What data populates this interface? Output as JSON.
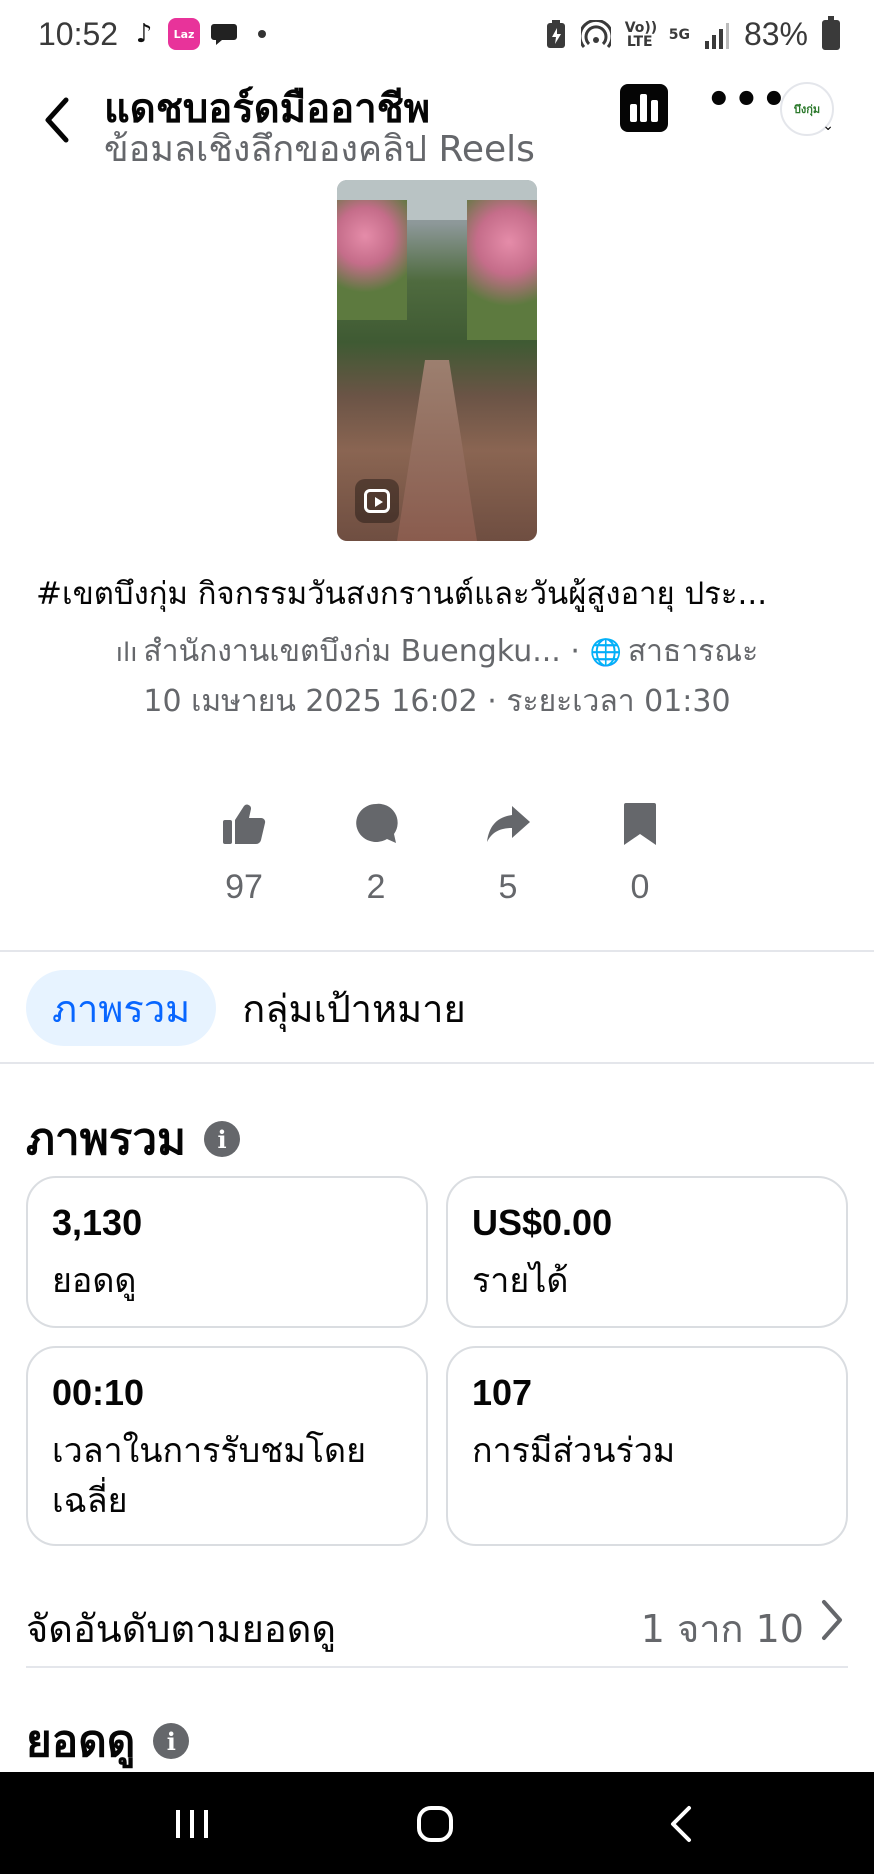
{
  "status_bar": {
    "time": "10:52",
    "network": "5G",
    "volte": "Vo)) LTE",
    "battery": "83%",
    "apps": [
      "tiktok-icon",
      "lazada-icon",
      "chat-bubble-icon"
    ],
    "laz_label": "Laz"
  },
  "header": {
    "title": "แดชบอร์ดมืออาชีพ",
    "subtitle": "ข้อมลเชิงลึกของคลิป Reels",
    "more": "•••",
    "avatar_text": "บึงกุ่ม"
  },
  "post": {
    "caption": "#เขตบึงกุ่ม กิจกรรมวันสงกรานต์และวันผู้สูงอายุ ประ...",
    "page_name": "สำนักงานเขตบึงก่ม Buengku...",
    "separator": "·",
    "privacy": "สาธารณะ",
    "date": "10 เมษายน  2025 16:02",
    "duration": "· ระยะเวลา 01:30"
  },
  "engagement": {
    "likes": "97",
    "comments": "2",
    "shares": "5",
    "saves": "0"
  },
  "tabs": [
    {
      "label": "ภาพรวม",
      "active": true
    },
    {
      "label": "กลุ่มเป้าหมาย",
      "active": false
    }
  ],
  "overview": {
    "title": "ภาพรวม",
    "cards": [
      {
        "value": "3,130",
        "label": "ยอดดู"
      },
      {
        "value": "US$0.00",
        "label": "รายได้"
      },
      {
        "value": "00:10",
        "label": "เวลาในการรับชมโดยเฉลี่ย"
      },
      {
        "value": "107",
        "label": "การมีส่วนร่วม"
      }
    ]
  },
  "sort": {
    "label": "จัดอันดับตามยอดดู",
    "value": "1 จาก 10"
  },
  "views_section": {
    "title": "ยอดดู"
  },
  "colors": {
    "accent": "#0866ff",
    "tab_active_bg": "#e7f3ff",
    "secondary_text": "#65676b",
    "border": "#dadde1"
  }
}
